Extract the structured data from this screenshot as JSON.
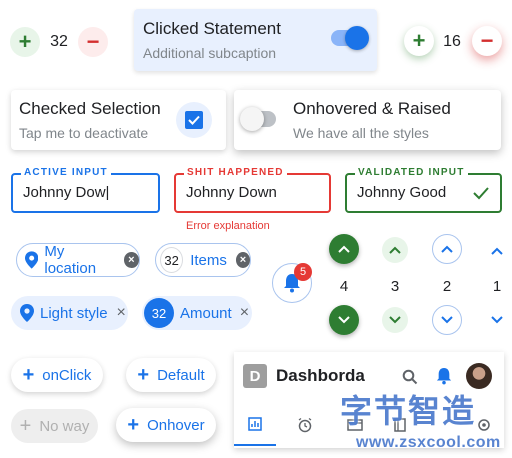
{
  "steppers": {
    "left": {
      "value": "32",
      "plus": "+",
      "minus": "−"
    },
    "right": {
      "value": "16",
      "plus": "+",
      "minus": "−"
    }
  },
  "toggle_card": {
    "title": "Clicked Statement",
    "subtitle": "Additional subcaption",
    "on": true
  },
  "checked_card": {
    "title": "Checked Selection",
    "subtitle": "Tap me to deactivate",
    "checked": true
  },
  "hover_card": {
    "title": "Onhovered & Raised",
    "subtitle": "We have all the styles",
    "on": false
  },
  "inputs": {
    "active": {
      "label": "ACTIVE INPUT",
      "value": "Johnny Dow|",
      "color": "#1a73e8"
    },
    "error": {
      "label": "SHIT HAPPENED",
      "value": "Johnny Down",
      "error": "Error explanation",
      "color": "#e53935"
    },
    "valid": {
      "label": "VALIDATED INPUT",
      "value": "Johnny Good",
      "color": "#2e7d32"
    }
  },
  "chips": {
    "location": {
      "label": "My location",
      "close": "×"
    },
    "items": {
      "label": "Items",
      "count": "32",
      "close": "×"
    },
    "light": {
      "label": "Light style",
      "close": "×"
    },
    "amount": {
      "label": "Amount",
      "count": "32",
      "close": "×"
    }
  },
  "notification": {
    "badge": "5"
  },
  "arrows": {
    "values": [
      "4",
      "3",
      "2",
      "1"
    ]
  },
  "buttons": {
    "onclick": "onClick",
    "default": "Default",
    "noway": "No way",
    "onhover": "Onhover",
    "plus": "+"
  },
  "dashboard": {
    "avatar_letter": "D",
    "title": "Dashborda"
  },
  "watermark": {
    "text": "字节智造",
    "url": "www.zsxcool.com"
  },
  "colors": {
    "primary": "#1a73e8",
    "success": "#2e7d32",
    "danger": "#d32f2f"
  }
}
